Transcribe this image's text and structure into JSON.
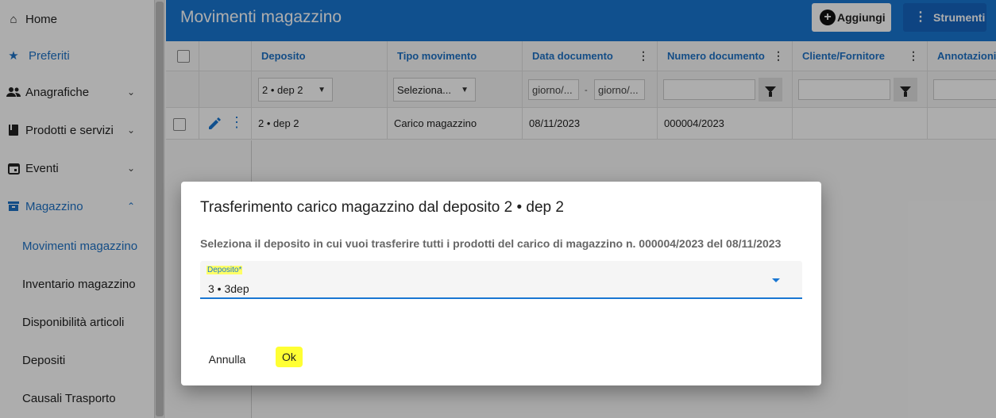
{
  "sidebar": {
    "items": [
      {
        "label": "Home",
        "icon": "home-icon"
      },
      {
        "label": "Preferiti",
        "icon": "star-icon"
      },
      {
        "label": "Anagrafiche",
        "icon": "people-icon"
      },
      {
        "label": "Prodotti e servizi",
        "icon": "book-icon"
      },
      {
        "label": "Eventi",
        "icon": "calendar-icon"
      },
      {
        "label": "Magazzino",
        "icon": "warehouse-icon"
      }
    ],
    "subitems": [
      {
        "label": "Movimenti magazzino"
      },
      {
        "label": "Inventario magazzino"
      },
      {
        "label": "Disponibilità articoli"
      },
      {
        "label": "Depositi"
      },
      {
        "label": "Causali Trasporto"
      }
    ]
  },
  "header": {
    "title": "Movimenti magazzino",
    "add_label": "Aggiungi",
    "tools_label": "Strumenti"
  },
  "table": {
    "columns": [
      "Deposito",
      "Tipo movimento",
      "Data documento",
      "Numero documento",
      "Cliente/Fornitore",
      "Annotazioni"
    ],
    "filters": {
      "deposito": "2 • dep 2",
      "tipo": "Seleziona...",
      "date_from": "giorno/...",
      "date_to": "giorno/..."
    },
    "rows": [
      {
        "deposito": "2 • dep 2",
        "tipo": "Carico magazzino",
        "data": "08/11/2023",
        "numero": "000004/2023",
        "cliente": "",
        "annotazioni": ""
      }
    ]
  },
  "dialog": {
    "title": "Trasferimento carico magazzino dal deposito 2 • dep 2",
    "text": "Seleziona il deposito in cui vuoi trasferire tutti i prodotti del carico di magazzino n. 000004/2023 del 08/11/2023",
    "field_label": "Deposito*",
    "field_value": "3 • 3dep",
    "cancel_label": "Annulla",
    "ok_label": "Ok"
  },
  "colors": {
    "primary": "#1976d2",
    "highlight": "#ffff33"
  }
}
